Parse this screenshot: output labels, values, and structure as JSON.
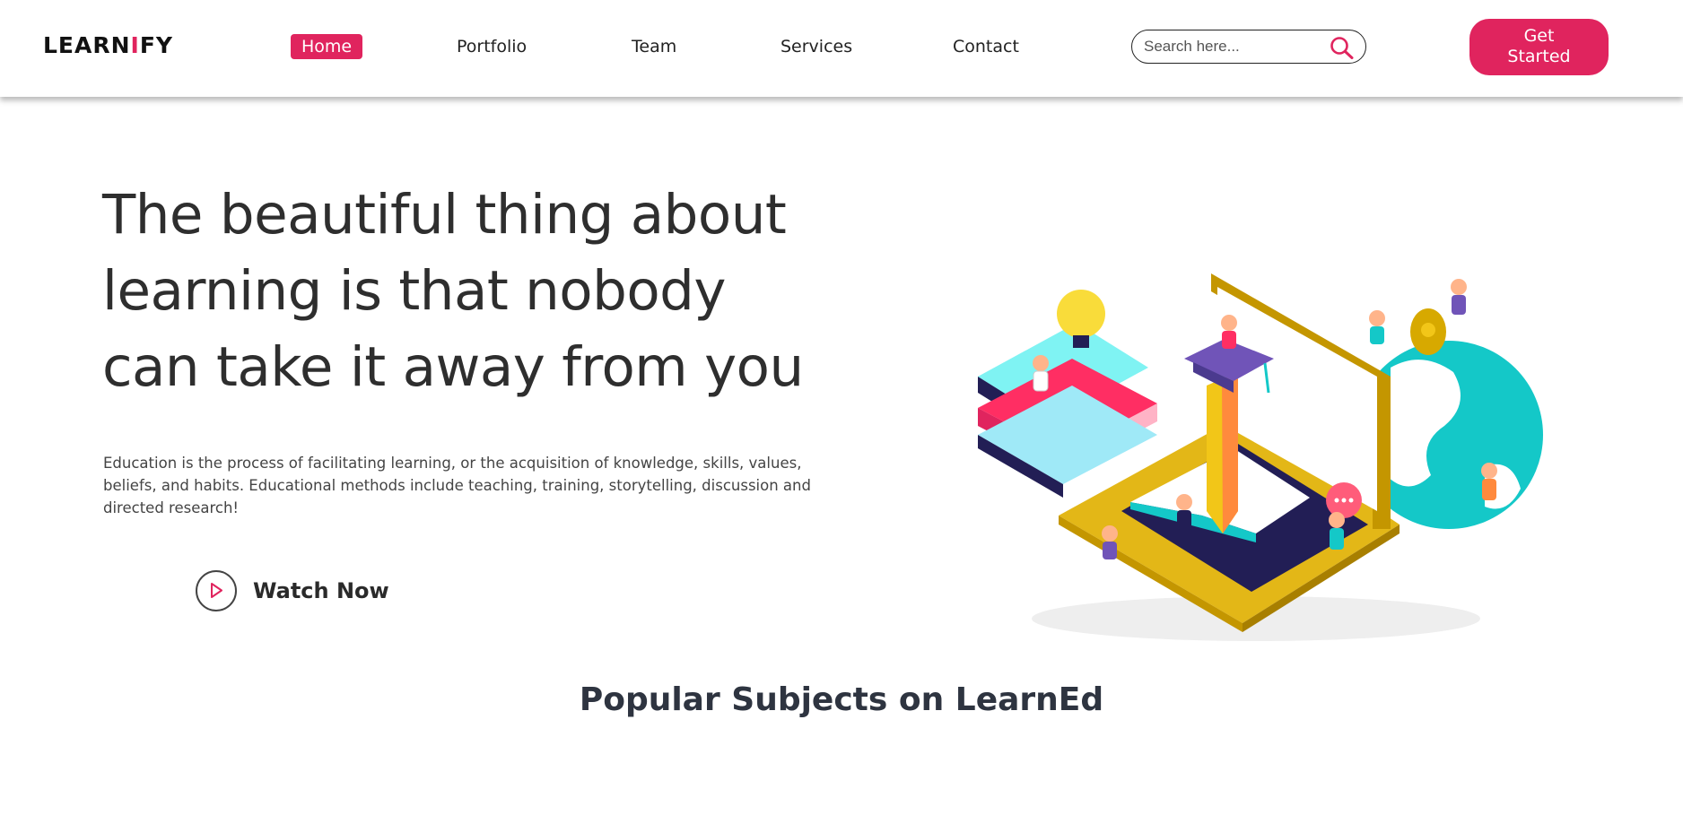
{
  "header": {
    "logo": {
      "part1": "LEARN",
      "part2": "I",
      "part3": "FY"
    },
    "nav": [
      {
        "label": "Home",
        "active": true
      },
      {
        "label": "Portfolio",
        "active": false
      },
      {
        "label": "Team",
        "active": false
      },
      {
        "label": "Services",
        "active": false
      },
      {
        "label": "Contact",
        "active": false
      }
    ],
    "search": {
      "placeholder": "Search here...",
      "icon": "search-icon"
    },
    "cta": {
      "line1": "Get",
      "line2": "Started"
    }
  },
  "hero": {
    "headline": [
      "The beautiful thing about",
      "learning is that nobody",
      "can take it away from you"
    ],
    "description": [
      "Education is the process of facilitating learning, or the acquisition of knowledge, skills, values,",
      "beliefs, and habits. Educational methods include teaching, training, storytelling, discussion and",
      "directed research!"
    ],
    "watch_label": "Watch Now",
    "watch_icon": "play-icon"
  },
  "section": {
    "title": "Popular Subjects on LearnEd"
  },
  "colors": {
    "accent": "#e0245e",
    "text": "#2e2e2e",
    "teal": "#14c8c8",
    "yellow": "#f2c618",
    "navy": "#221e55"
  }
}
